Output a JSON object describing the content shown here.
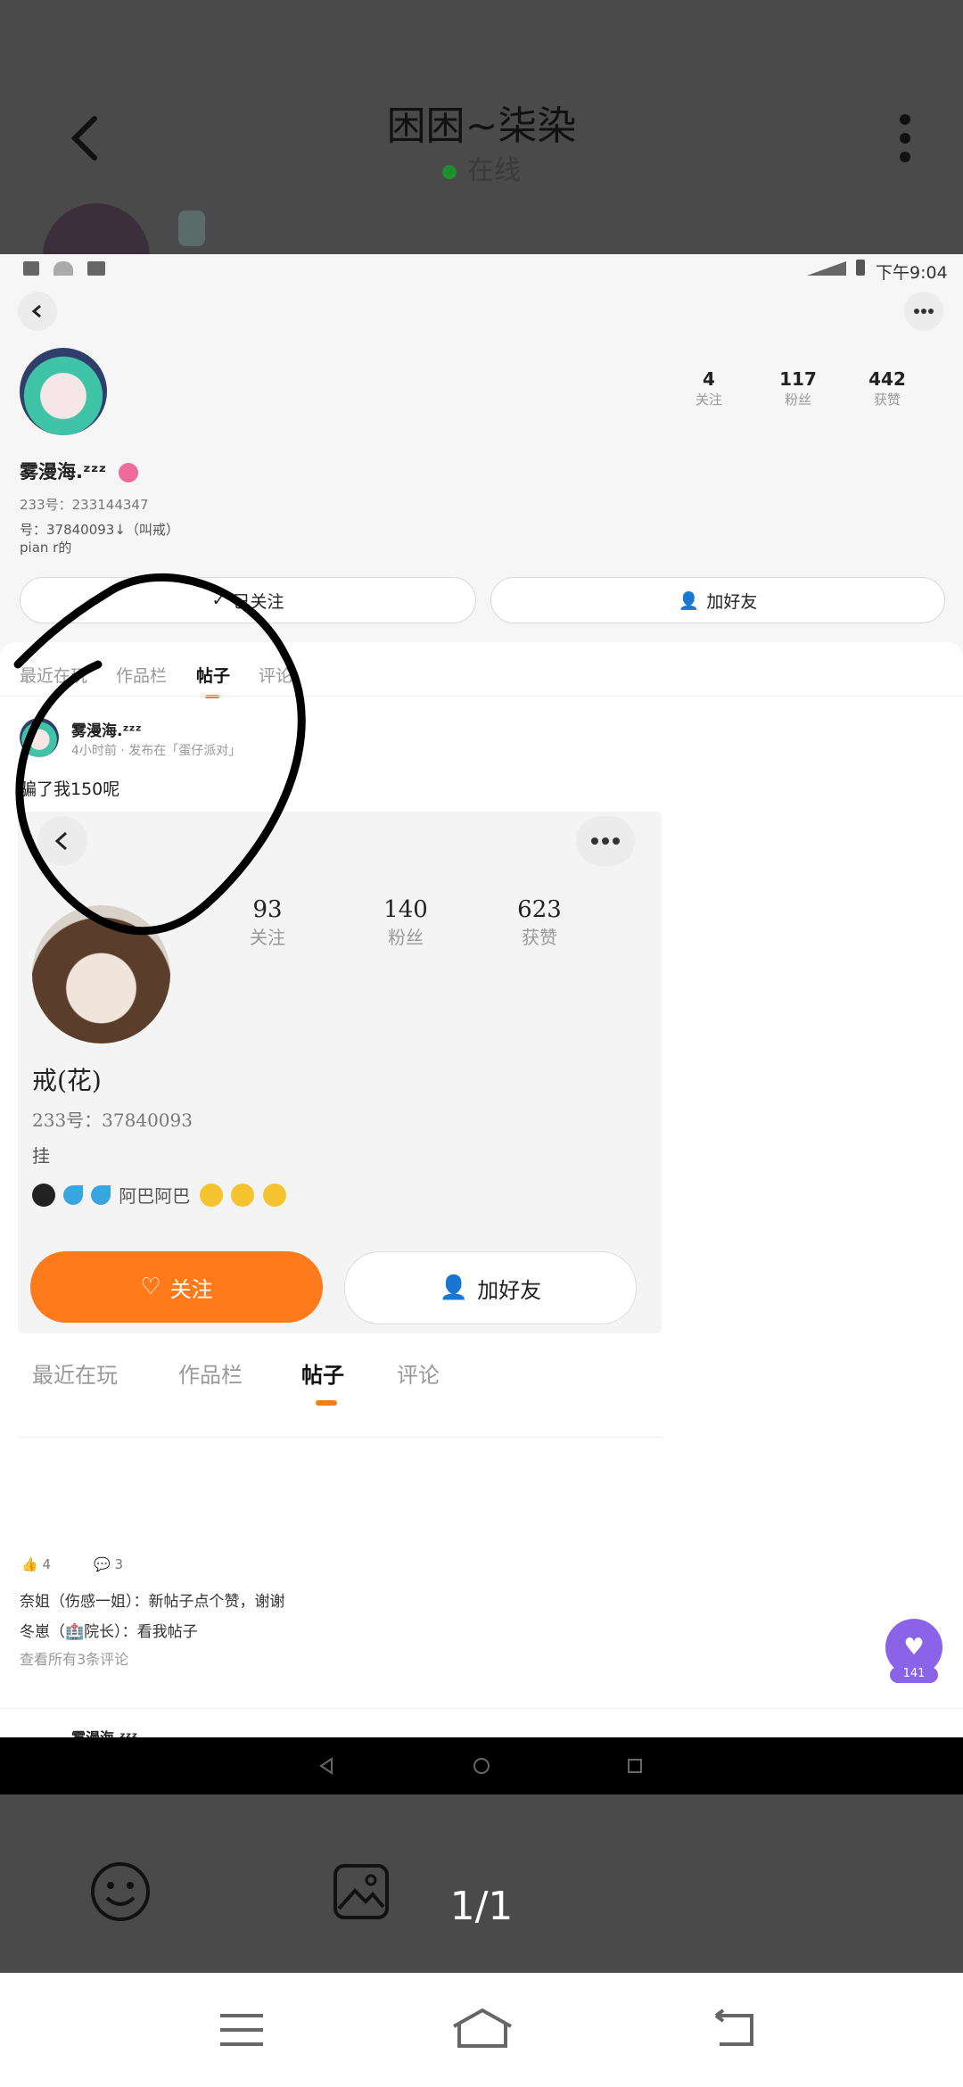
{
  "viewer": {
    "title": "困困~柒染",
    "status": "在线",
    "page_counter": "1/1",
    "online_color": "#1e8f2e"
  },
  "statusbar": {
    "time": "下午9:04"
  },
  "profile": {
    "name": "雾漫海.ᶻᶻᶻ",
    "id_line": "233号：233144347",
    "bio_line1": "号：37840093↓（叫戒）",
    "bio_line2": "pian r的",
    "stats": [
      {
        "num": "4",
        "label": "关注"
      },
      {
        "num": "117",
        "label": "粉丝"
      },
      {
        "num": "442",
        "label": "获赞"
      }
    ],
    "followed_label": "已关注",
    "add_friend_label": "加好友",
    "tabs": [
      "最近在玩",
      "作品栏",
      "帖子",
      "评论"
    ]
  },
  "post": {
    "author": "雾漫海.ᶻᶻᶻ",
    "meta": "4小时前 · 发布在「蛋仔派对」",
    "text": "骗了我150呢",
    "likes": "4",
    "comments": "3",
    "comment_lines": [
      {
        "user": "奈姐（伤感一姐）：",
        "text": "新帖子点个赞，谢谢"
      },
      {
        "user": "冬崽（🏥院长）：",
        "text": "看我帖子"
      }
    ],
    "view_all": "查看所有3条评论",
    "next_author": "雾漫海.ᶻᶻᶻ"
  },
  "inner": {
    "stats": [
      {
        "num": "93",
        "label": "关注"
      },
      {
        "num": "140",
        "label": "粉丝"
      },
      {
        "num": "623",
        "label": "获赞"
      }
    ],
    "name": "戒(花)",
    "id_line": "233号：37840093",
    "line2": "挂",
    "line3": "阿巴阿巴",
    "follow_label": "关注",
    "add_friend_label": "加好友",
    "tabs": [
      "最近在玩",
      "作品栏",
      "帖子",
      "评论"
    ]
  },
  "floating": {
    "count": "141",
    "color": "#8a63e8"
  },
  "accent": "#ff7a1a"
}
